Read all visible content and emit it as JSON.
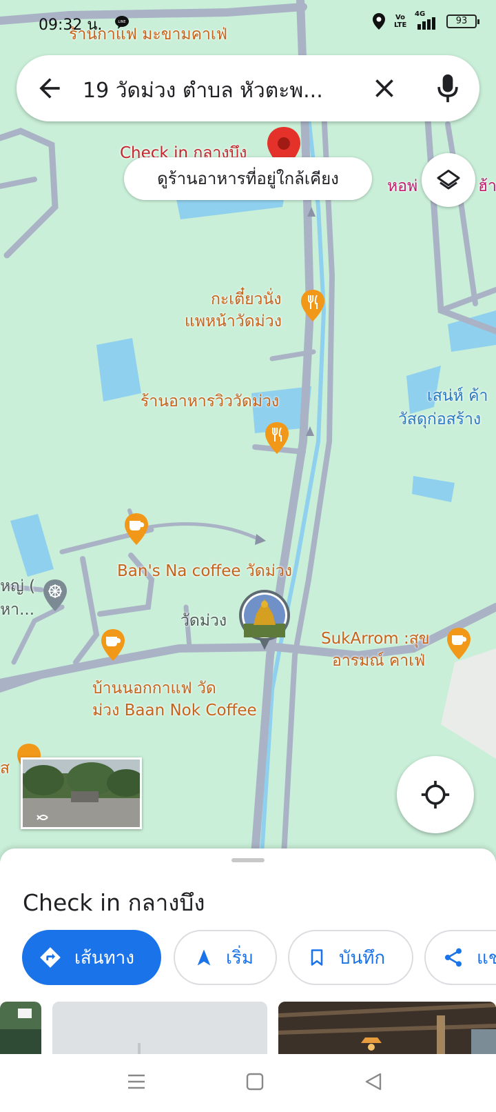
{
  "status_bar": {
    "time": "09:32 น.",
    "app_badge": "LINE",
    "signal": "4G",
    "volte": "Vo LTE",
    "battery": "93"
  },
  "search": {
    "query": "19 วัดม่วง ตำบล หัวตะพ..."
  },
  "map": {
    "nearby_button": "ดูร้านอาหารที่อยู่ใกล้เคียง",
    "selected_place_label": "Check in กลางบึง",
    "labels": {
      "top_cafe": "ร้านกาแฟ มะขามคาเฟ่",
      "noodle_line1": "กะเตี๋ยวนั่ง",
      "noodle_line2": "แพหน้าวัดม่วง",
      "restaurant_view": "ร้านอาหารวิววัดม่วง",
      "hardware_line1": "เสน่ห์ ค้า",
      "hardware_line2": "วัสดุก่อสร้าง",
      "right_pink": "หอพ่",
      "right_pink_2": "ฮ้า",
      "bans_coffee": "Ban's Na coffee วัดม่วง",
      "wat_muang": "วัดม่วง",
      "left_temple_line1": "หญ่ (",
      "left_temple_line2": "หา...",
      "sukarrom_line1": "SukArrom :สุข",
      "sukarrom_line2": "อารมณ์ คาเฟ่",
      "baan_nok_line1": "บ้านนอกกาแฟ วัด",
      "baan_nok_line2": "ม่วง Baan Nok Coffee",
      "left_edge": "ส"
    }
  },
  "sheet": {
    "title": "Check in กลางบึง",
    "chips": {
      "directions": "เส้นทาง",
      "start": "เริ่ม",
      "save": "บันทึก",
      "share": "แช"
    }
  },
  "colors": {
    "map_bg": "#c9efd8",
    "road": "#aab3c6",
    "water": "#8fd0ee",
    "poi_orange": "#f29818",
    "accent_blue": "#1a73e8",
    "pin_red": "#e4322b"
  }
}
